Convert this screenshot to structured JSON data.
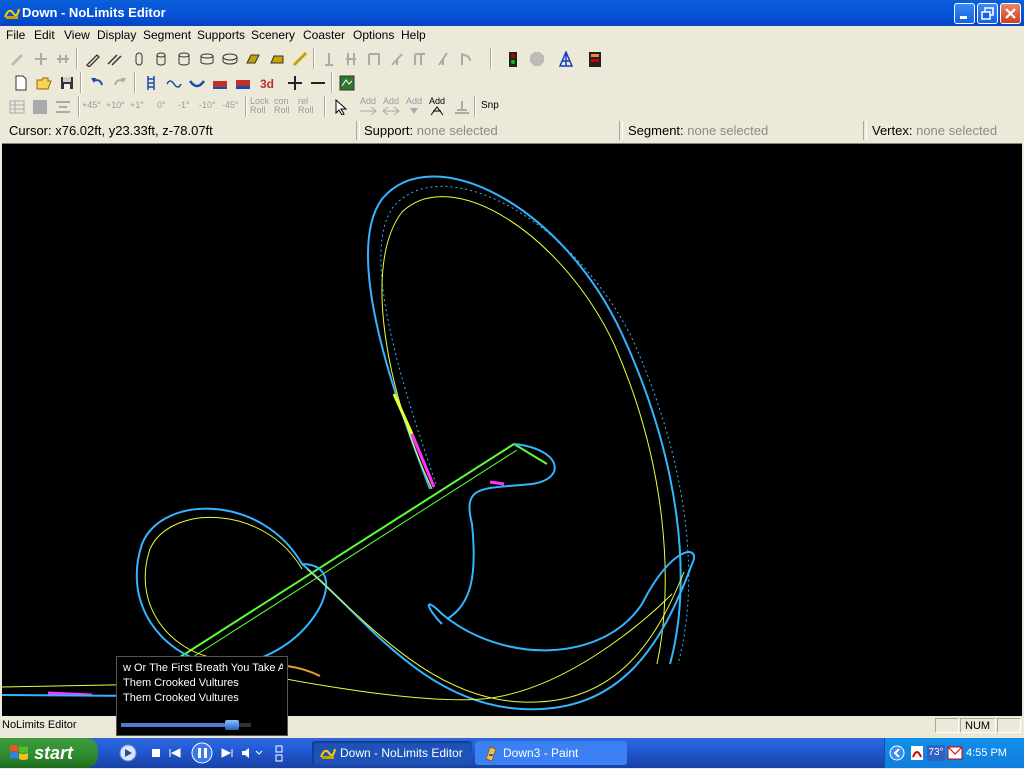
{
  "window": {
    "title": "Down - NoLimits Editor",
    "accent": "#0551d6"
  },
  "menu": {
    "items": [
      "File",
      "Edit",
      "View",
      "Display",
      "Segment",
      "Supports",
      "Scenery",
      "Coaster",
      "Options",
      "Help"
    ]
  },
  "toolbar3": {
    "rot_pos45": "+45°",
    "rot_pos10": "+10°",
    "rot_pos1": "+1°",
    "rot_0": "0°",
    "rot_neg1": "-1°",
    "rot_neg10": "-10°",
    "rot_neg45": "-45°",
    "lock_roll_1": "Lock",
    "lock_roll_2": "Roll",
    "con_roll_1": "con",
    "con_roll_2": "Roll",
    "rel_roll_1": "rel",
    "rel_roll_2": "Roll",
    "add1": "Add",
    "add2": "Add",
    "add3": "Add",
    "add4": "Add",
    "snap": "Snp"
  },
  "status": {
    "cursor": "Cursor: x76.02ft, y23.33ft, z-78.07ft",
    "support_label": "Support:",
    "support_value": "none selected",
    "segment_label": "Segment:",
    "segment_value": "none selected",
    "vertex_label": "Vertex:",
    "vertex_value": "none selected"
  },
  "bottom_status": {
    "app_name": "NoLimits Editor",
    "num": "NUM"
  },
  "media_popup": {
    "line1": "w Or The First Breath You Take A",
    "line2": "Them Crooked Vultures",
    "line3": "Them Crooked Vultures",
    "progress": 0.85
  },
  "taskbar": {
    "start_label": "start",
    "items": [
      {
        "label": "Down - NoLimits Editor",
        "active": true
      },
      {
        "label": "Down3 - Paint",
        "active": false
      }
    ],
    "temperature": "73°",
    "clock": "4:55 PM"
  },
  "colors": {
    "track_blue": "#33b5ff",
    "track_yellow": "#e8ff3a",
    "track_green": "#5cff3a",
    "track_magenta": "#ff33ff"
  }
}
